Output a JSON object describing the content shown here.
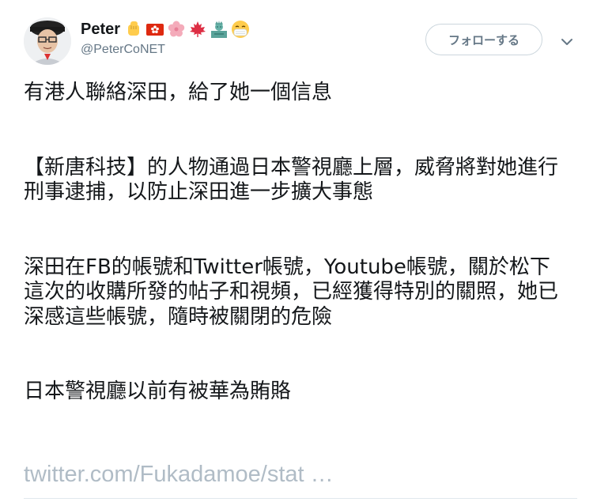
{
  "author": {
    "display_name": "Peter",
    "screen_name": "@PeterCoNET",
    "name_emojis": [
      "raised-fist-icon",
      "hong-kong-flag-icon",
      "cherry-blossom-icon",
      "maple-leaf-icon",
      "statue-of-liberty-icon",
      "face-mask-icon"
    ]
  },
  "follow_button": {
    "label": "フォローする"
  },
  "tweet": {
    "line1": "有港人聯絡深田，給了她一個信息",
    "para2": "【新唐科技】的人物通過日本警視廳上層，威脅將對她進行刑事逮捕，以防止深田進一步擴大事態",
    "para3": "深田在FB的帳號和Twitter帳號，Youtube帳號，關於松下這次的收購所發的帖子和視頻，已經獲得特別的關照，她已深感這些帳號，隨時被關閉的危險",
    "para4": "日本警視廳以前有被華為賄賂",
    "link_text": "twitter.com/Fukadamoe/stat …"
  },
  "colors": {
    "text": "#14171a",
    "secondary": "#657786",
    "link_faded": "#b0bcc6",
    "border": "#ccd6dd"
  }
}
